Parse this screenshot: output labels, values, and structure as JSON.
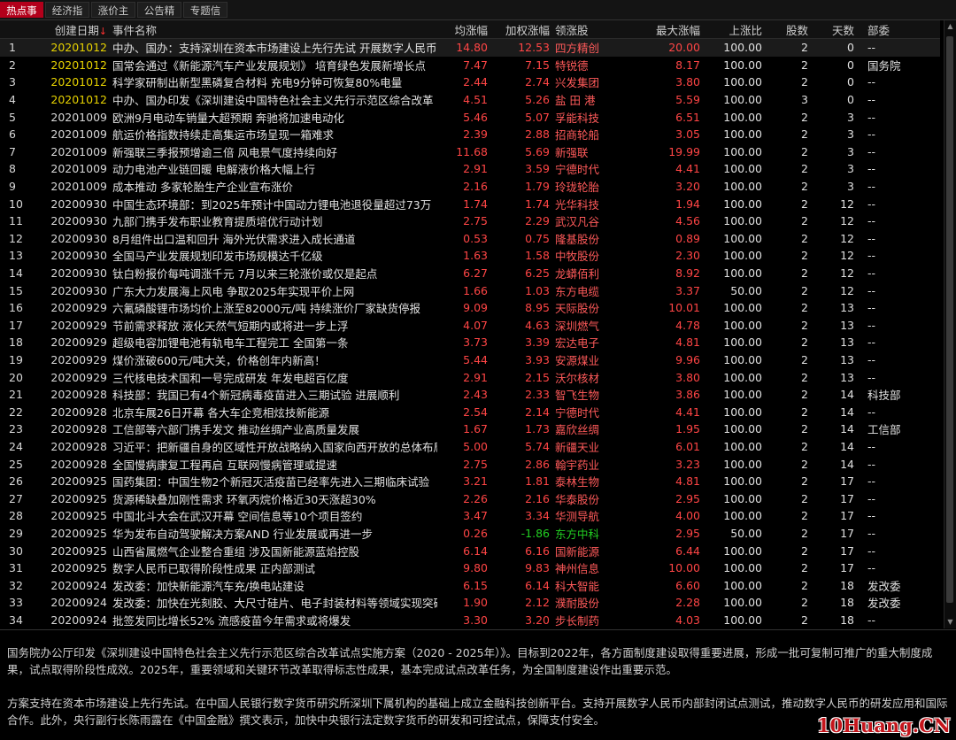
{
  "tabs": [
    {
      "label": "热点事件",
      "active": true
    },
    {
      "label": "经济指标",
      "active": false
    },
    {
      "label": "涨价主题",
      "active": false
    },
    {
      "label": "公告精选",
      "active": false
    },
    {
      "label": "专题信息",
      "active": false
    }
  ],
  "table": {
    "headers": {
      "idx": "",
      "date": "创建日期",
      "event": "事件名称",
      "avg": "均涨幅",
      "wavg": "加权涨幅",
      "lead": "领涨股",
      "max": "最大涨幅",
      "up": "上涨比",
      "count": "股数",
      "days": "天数",
      "dept": "部委"
    },
    "sort_indicator": "↓",
    "rows": [
      {
        "idx": "1",
        "date": "20201012",
        "event": "中办、国办：支持深圳在资本市场建设上先行先试 开展数字人民币",
        "avg": "14.80",
        "wavg": "12.53",
        "lead": "四方精创",
        "max": "20.00",
        "up": "100.00",
        "count": "2",
        "days": "0",
        "dept": "--"
      },
      {
        "idx": "2",
        "date": "20201012",
        "event": "国常会通过《新能源汽车产业发展规划》 培育绿色发展新增长点",
        "avg": "7.47",
        "wavg": "7.15",
        "lead": "特锐德",
        "max": "8.17",
        "up": "100.00",
        "count": "2",
        "days": "0",
        "dept": "国务院"
      },
      {
        "idx": "3",
        "date": "20201012",
        "event": "科学家研制出新型黑磷复合材料 充电9分钟可恢复80%电量",
        "avg": "2.44",
        "wavg": "2.74",
        "lead": "兴发集团",
        "max": "3.80",
        "up": "100.00",
        "count": "2",
        "days": "0",
        "dept": "--"
      },
      {
        "idx": "4",
        "date": "20201012",
        "event": "中办、国办印发《深圳建设中国特色社会主义先行示范区综合改革",
        "avg": "4.51",
        "wavg": "5.26",
        "lead": "盐 田 港",
        "max": "5.59",
        "up": "100.00",
        "count": "3",
        "days": "0",
        "dept": "--"
      },
      {
        "idx": "5",
        "date": "20201009",
        "event": "欧洲9月电动车销量大超预期 奔驰将加速电动化",
        "avg": "5.46",
        "wavg": "5.07",
        "lead": "孚能科技",
        "max": "6.51",
        "up": "100.00",
        "count": "2",
        "days": "3",
        "dept": "--"
      },
      {
        "idx": "6",
        "date": "20201009",
        "event": "航运价格指数持续走高集运市场呈现一箱难求",
        "avg": "2.39",
        "wavg": "2.88",
        "lead": "招商轮船",
        "max": "3.05",
        "up": "100.00",
        "count": "2",
        "days": "3",
        "dept": "--"
      },
      {
        "idx": "7",
        "date": "20201009",
        "event": "新强联三季报预增逾三倍 风电景气度持续向好",
        "avg": "11.68",
        "wavg": "5.69",
        "lead": "新强联",
        "max": "19.99",
        "up": "100.00",
        "count": "2",
        "days": "3",
        "dept": "--"
      },
      {
        "idx": "8",
        "date": "20201009",
        "event": "动力电池产业链回暖 电解液价格大幅上行",
        "avg": "2.91",
        "wavg": "3.59",
        "lead": "宁德时代",
        "max": "4.41",
        "up": "100.00",
        "count": "2",
        "days": "3",
        "dept": "--"
      },
      {
        "idx": "9",
        "date": "20201009",
        "event": "成本推动 多家轮胎生产企业宣布涨价",
        "avg": "2.16",
        "wavg": "1.79",
        "lead": "玲珑轮胎",
        "max": "3.20",
        "up": "100.00",
        "count": "2",
        "days": "3",
        "dept": "--"
      },
      {
        "idx": "10",
        "date": "20200930",
        "event": "中国生态环境部：到2025年预计中国动力锂电池退役量超过73万",
        "avg": "1.74",
        "wavg": "1.74",
        "lead": "光华科技",
        "max": "1.94",
        "up": "100.00",
        "count": "2",
        "days": "12",
        "dept": "--"
      },
      {
        "idx": "11",
        "date": "20200930",
        "event": "九部门携手发布职业教育提质培优行动计划",
        "avg": "2.75",
        "wavg": "2.29",
        "lead": "武汉凡谷",
        "max": "4.56",
        "up": "100.00",
        "count": "2",
        "days": "12",
        "dept": "--"
      },
      {
        "idx": "12",
        "date": "20200930",
        "event": "8月组件出口温和回升 海外光伏需求进入成长通道",
        "avg": "0.53",
        "wavg": "0.75",
        "lead": "隆基股份",
        "max": "0.89",
        "up": "100.00",
        "count": "2",
        "days": "12",
        "dept": "--"
      },
      {
        "idx": "13",
        "date": "20200930",
        "event": "全国马产业发展规划印发市场规模达千亿级",
        "avg": "1.63",
        "wavg": "1.58",
        "lead": "中牧股份",
        "max": "2.30",
        "up": "100.00",
        "count": "2",
        "days": "12",
        "dept": "--"
      },
      {
        "idx": "14",
        "date": "20200930",
        "event": "钛白粉报价每吨调涨千元 7月以来三轮涨价或仅是起点",
        "avg": "6.27",
        "wavg": "6.25",
        "lead": "龙蟒佰利",
        "max": "8.92",
        "up": "100.00",
        "count": "2",
        "days": "12",
        "dept": "--"
      },
      {
        "idx": "15",
        "date": "20200930",
        "event": "广东大力发展海上风电 争取2025年实现平价上网",
        "avg": "1.66",
        "wavg": "1.03",
        "lead": "东方电缆",
        "max": "3.37",
        "up": "50.00",
        "count": "2",
        "days": "12",
        "dept": "--"
      },
      {
        "idx": "16",
        "date": "20200929",
        "event": "六氟磷酸锂市场均价上涨至82000元/吨 持续涨价厂家缺货停报",
        "avg": "9.09",
        "wavg": "8.95",
        "lead": "天际股份",
        "max": "10.01",
        "up": "100.00",
        "count": "2",
        "days": "13",
        "dept": "--"
      },
      {
        "idx": "17",
        "date": "20200929",
        "event": "节前需求释放 液化天然气短期内或将进一步上浮",
        "avg": "4.07",
        "wavg": "4.63",
        "lead": "深圳燃气",
        "max": "4.78",
        "up": "100.00",
        "count": "2",
        "days": "13",
        "dept": "--"
      },
      {
        "idx": "18",
        "date": "20200929",
        "event": "超级电容加锂电池有轨电车工程完工 全国第一条",
        "avg": "3.73",
        "wavg": "3.39",
        "lead": "宏达电子",
        "max": "4.81",
        "up": "100.00",
        "count": "2",
        "days": "13",
        "dept": "--"
      },
      {
        "idx": "19",
        "date": "20200929",
        "event": "煤价涨破600元/吨大关，价格创年内新高！",
        "avg": "5.44",
        "wavg": "3.93",
        "lead": "安源煤业",
        "max": "9.96",
        "up": "100.00",
        "count": "2",
        "days": "13",
        "dept": "--"
      },
      {
        "idx": "20",
        "date": "20200929",
        "event": "三代核电技术国和一号完成研发 年发电超百亿度",
        "avg": "2.91",
        "wavg": "2.15",
        "lead": "沃尔核材",
        "max": "3.80",
        "up": "100.00",
        "count": "2",
        "days": "13",
        "dept": "--"
      },
      {
        "idx": "21",
        "date": "20200928",
        "event": "科技部：我国已有4个新冠病毒疫苗进入三期试验 进展顺利",
        "avg": "2.43",
        "wavg": "2.33",
        "lead": "智飞生物",
        "max": "3.86",
        "up": "100.00",
        "count": "2",
        "days": "14",
        "dept": "科技部"
      },
      {
        "idx": "22",
        "date": "20200928",
        "event": "北京车展26日开幕 各大车企竞相炫技新能源",
        "avg": "2.54",
        "wavg": "2.14",
        "lead": "宁德时代",
        "max": "4.41",
        "up": "100.00",
        "count": "2",
        "days": "14",
        "dept": "--"
      },
      {
        "idx": "23",
        "date": "20200928",
        "event": "工信部等六部门携手发文 推动丝绸产业高质量发展",
        "avg": "1.67",
        "wavg": "1.73",
        "lead": "嘉欣丝绸",
        "max": "1.95",
        "up": "100.00",
        "count": "2",
        "days": "14",
        "dept": "工信部"
      },
      {
        "idx": "24",
        "date": "20200928",
        "event": "习近平：把新疆自身的区域性开放战略纳入国家向西开放的总体布局",
        "avg": "5.00",
        "wavg": "5.74",
        "lead": "新疆天业",
        "max": "6.01",
        "up": "100.00",
        "count": "2",
        "days": "14",
        "dept": "--"
      },
      {
        "idx": "25",
        "date": "20200928",
        "event": "全国慢病康复工程再启 互联网慢病管理或提速",
        "avg": "2.75",
        "wavg": "2.86",
        "lead": "翰宇药业",
        "max": "3.23",
        "up": "100.00",
        "count": "2",
        "days": "14",
        "dept": "--"
      },
      {
        "idx": "26",
        "date": "20200925",
        "event": "国药集团：中国生物2个新冠灭活疫苗已经率先进入三期临床试验",
        "avg": "3.21",
        "wavg": "1.81",
        "lead": "泰林生物",
        "max": "4.81",
        "up": "100.00",
        "count": "2",
        "days": "17",
        "dept": "--"
      },
      {
        "idx": "27",
        "date": "20200925",
        "event": "货源稀缺叠加刚性需求 环氧丙烷价格近30天涨超30%",
        "avg": "2.26",
        "wavg": "2.16",
        "lead": "华泰股份",
        "max": "2.95",
        "up": "100.00",
        "count": "2",
        "days": "17",
        "dept": "--"
      },
      {
        "idx": "28",
        "date": "20200925",
        "event": "中国北斗大会在武汉开幕 空间信息等10个项目签约",
        "avg": "3.47",
        "wavg": "3.34",
        "lead": "华测导航",
        "max": "4.00",
        "up": "100.00",
        "count": "2",
        "days": "17",
        "dept": "--"
      },
      {
        "idx": "29",
        "date": "20200925",
        "event": "华为发布自动驾驶解决方案AND 行业发展或再进一步",
        "avg": "0.26",
        "wavg": "-1.86",
        "lead": "东方中科",
        "max": "2.95",
        "up": "50.00",
        "count": "2",
        "days": "17",
        "dept": "--"
      },
      {
        "idx": "30",
        "date": "20200925",
        "event": "山西省属燃气企业整合重组 涉及国新能源蓝焰控股",
        "avg": "6.14",
        "wavg": "6.16",
        "lead": "国新能源",
        "max": "6.44",
        "up": "100.00",
        "count": "2",
        "days": "17",
        "dept": "--"
      },
      {
        "idx": "31",
        "date": "20200925",
        "event": "数字人民币已取得阶段性成果 正内部测试",
        "avg": "9.80",
        "wavg": "9.83",
        "lead": "神州信息",
        "max": "10.00",
        "up": "100.00",
        "count": "2",
        "days": "17",
        "dept": "--"
      },
      {
        "idx": "32",
        "date": "20200924",
        "event": "发改委：加快新能源汽车充/换电站建设",
        "avg": "6.15",
        "wavg": "6.14",
        "lead": "科大智能",
        "max": "6.60",
        "up": "100.00",
        "count": "2",
        "days": "18",
        "dept": "发改委"
      },
      {
        "idx": "33",
        "date": "20200924",
        "event": "发改委：加快在光刻胶、大尺寸硅片、电子封装材料等领域实现突破",
        "avg": "1.90",
        "wavg": "2.12",
        "lead": "濮耐股份",
        "max": "2.28",
        "up": "100.00",
        "count": "2",
        "days": "18",
        "dept": "发改委"
      },
      {
        "idx": "34",
        "date": "20200924",
        "event": "批签发同比增长52% 流感疫苗今年需求或将爆发",
        "avg": "3.30",
        "wavg": "3.20",
        "lead": "步长制药",
        "max": "4.03",
        "up": "100.00",
        "count": "2",
        "days": "18",
        "dept": "--"
      }
    ]
  },
  "detail": {
    "para1": "国务院办公厅印发《深圳建设中国特色社会主义先行示范区综合改革试点实施方案（2020 - 2025年）》。目标到2022年，各方面制度建设取得重要进展，形成一批可复制可推广的重大制度成果，试点取得阶段性成效。2025年，重要领域和关键环节改革取得标志性成果，基本完成试点改革任务，为全国制度建设作出重要示范。",
    "para2": "方案支持在资本市场建设上先行先试。在中国人民银行数字货币研究所深圳下属机构的基础上成立金融科技创新平台。支持开展数字人民币内部封闭试点测试，推动数字人民币的研发应用和国际合作。此外，央行副行长陈雨露在《中国金融》撰文表示，加快中央银行法定数字货币的研发和可控试点，保障支付安全。"
  },
  "watermark": "10Huang.CN",
  "colors": {
    "up": "#ff4545",
    "down": "#22d122",
    "date_highlight": "#e7d200",
    "tab_active": "#b3001b"
  }
}
